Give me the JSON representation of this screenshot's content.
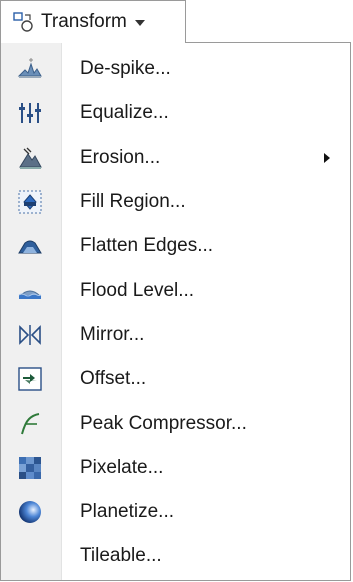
{
  "menu": {
    "title": "Transform",
    "items": [
      {
        "label": "De-spike...",
        "icon": "despike-icon"
      },
      {
        "label": "Equalize...",
        "icon": "equalize-icon"
      },
      {
        "label": "Erosion...",
        "icon": "erosion-icon",
        "has_submenu": true
      },
      {
        "label": "Fill Region...",
        "icon": "fill-region-icon"
      },
      {
        "label": "Flatten Edges...",
        "icon": "flatten-edges-icon"
      },
      {
        "label": "Flood Level...",
        "icon": "flood-level-icon"
      },
      {
        "label": "Mirror...",
        "icon": "mirror-icon"
      },
      {
        "label": "Offset...",
        "icon": "offset-icon"
      },
      {
        "label": "Peak Compressor...",
        "icon": "peak-compressor-icon"
      },
      {
        "label": "Pixelate...",
        "icon": "pixelate-icon"
      },
      {
        "label": "Planetize...",
        "icon": "planetize-icon"
      },
      {
        "label": "Tileable...",
        "icon": ""
      }
    ]
  }
}
